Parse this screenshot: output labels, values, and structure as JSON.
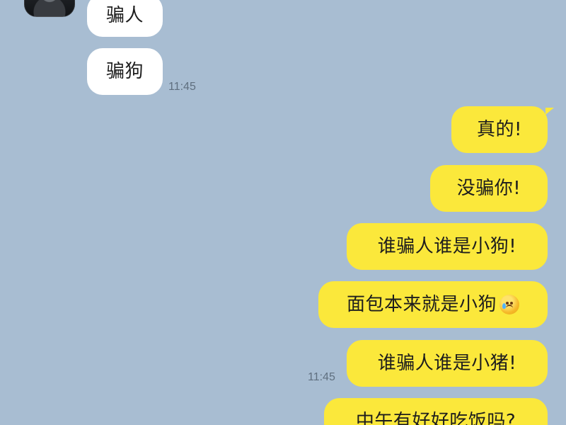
{
  "chat": {
    "left_messages": [
      {
        "text": "骗人"
      },
      {
        "text": "骗狗",
        "time": "11:45"
      }
    ],
    "right_messages": [
      {
        "text": "真的!"
      },
      {
        "text": "没骗你!"
      },
      {
        "text": "谁骗人谁是小狗!"
      },
      {
        "text": "面包本来就是小狗",
        "emoji": "crying-face-icon"
      },
      {
        "text": "谁骗人谁是小猪!",
        "time": "11:45"
      },
      {
        "text": "中午有好好吃饭吗?"
      }
    ]
  },
  "colors": {
    "background": "#a8bdd2",
    "incoming_bubble": "#ffffff",
    "outgoing_bubble": "#fbe83b",
    "timestamp": "#5f6f7f",
    "text": "#1d1d1d"
  }
}
